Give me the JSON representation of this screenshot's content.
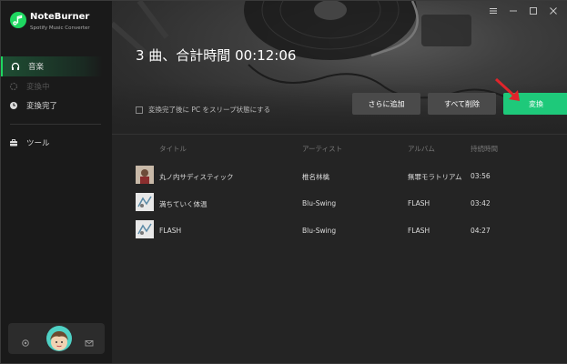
{
  "app": {
    "name": "NoteBurner",
    "subtitle": "Spotify Music Converter"
  },
  "sidebar": {
    "items": [
      {
        "label": "音楽",
        "icon": "headphones-icon",
        "state": "active"
      },
      {
        "label": "変換中",
        "icon": "loading-icon",
        "state": "disabled"
      },
      {
        "label": "変換完了",
        "icon": "clock-icon",
        "state": "normal"
      },
      {
        "label": "ツール",
        "icon": "toolbox-icon",
        "state": "normal"
      }
    ],
    "footer_icons": [
      "settings-icon",
      "avatar",
      "mail-icon"
    ]
  },
  "window_controls": [
    "menu-icon",
    "minimize-icon",
    "maximize-icon",
    "close-icon"
  ],
  "summary": "3 曲、合計時間 00:12:06",
  "sleep_option": "変換完了後に PC をスリープ状態にする",
  "buttons": {
    "add": "さらに追加",
    "delete_all": "すべて削除",
    "convert": "変換"
  },
  "table": {
    "headers": [
      "タイトル",
      "アーティスト",
      "アルバム",
      "持続時間"
    ],
    "rows": [
      {
        "title": "丸ノ内サディスティック",
        "artist": "椎名林檎",
        "album": "無罪モラトリアム",
        "duration": "03:56"
      },
      {
        "title": "満ちていく体温",
        "artist": "Blu-Swing",
        "album": "FLASH",
        "duration": "03:42"
      },
      {
        "title": "FLASH",
        "artist": "Blu-Swing",
        "album": "FLASH",
        "duration": "04:27"
      }
    ]
  },
  "colors": {
    "accent": "#1ed760",
    "convert_button": "#1ec97a",
    "pointer": "#e0242b"
  }
}
